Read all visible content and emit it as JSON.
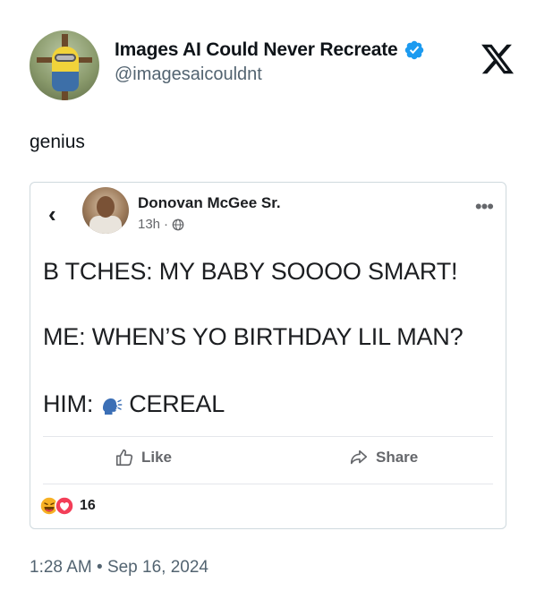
{
  "tweet": {
    "author": {
      "display_name": "Images AI Could Never Recreate",
      "handle": "@imagesaicouldnt",
      "verified": true
    },
    "text": "genius",
    "timestamp": "1:28 AM",
    "date": "Sep 16, 2024",
    "separator": "•"
  },
  "embedded_post": {
    "author_name": "Donovan McGee Sr.",
    "time_ago": "13h",
    "meta_separator": "·",
    "lines": [
      "B TCHES: MY BABY SOOOO SMART!",
      "ME: WHEN’S YO BIRTHDAY LIL MAN?"
    ],
    "last_line_prefix": "HIM:",
    "last_line_suffix": "CEREAL",
    "like_label": "Like",
    "share_label": "Share",
    "reaction_count": "16"
  },
  "icons": {
    "verified": "verified-badge-icon",
    "brand": "x-logo-icon",
    "back": "chevron-left-icon",
    "more": "more-horizontal-icon",
    "privacy": "globe-icon",
    "speaking_head": "speaking-head-icon",
    "like": "thumbs-up-icon",
    "share": "share-arrow-icon",
    "reactions": [
      "haha-icon",
      "love-icon"
    ]
  },
  "colors": {
    "verified_blue": "#1d9bf0",
    "text_primary": "#0f1419",
    "text_secondary": "#536471",
    "fb_text": "#1c1e21",
    "fb_secondary": "#65676b",
    "love_red": "#f33e58",
    "haha_yellow": "#f7b125"
  }
}
